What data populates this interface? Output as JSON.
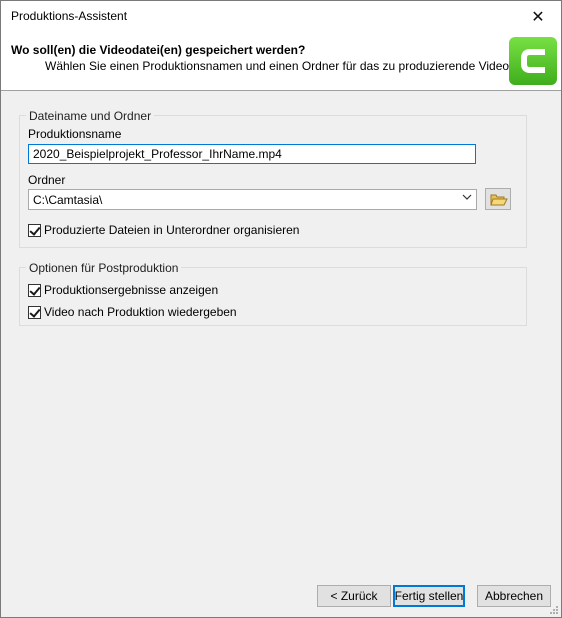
{
  "window": {
    "title": "Produktions-Assistent",
    "close_glyph": "✕"
  },
  "header": {
    "heading": "Wo soll(en) die Videodatei(en) gespeichert werden?",
    "subheading": "Wählen Sie einen Produktionsnamen und einen Ordner für das zu produzierende Video.",
    "logo_icon": "camtasia-logo-icon",
    "logo_letter": "C",
    "accent_color": "#4cbb26"
  },
  "group_file": {
    "legend": "Dateiname und Ordner",
    "production_name_label": "Produktionsname",
    "production_name_value": "2020_Beispielprojekt_Professor_IhrName.mp4",
    "folder_label": "Ordner",
    "folder_value": "C:\\Camtasia\\",
    "browse_icon": "folder-open-icon",
    "subfolder_checkbox_label": "Produzierte Dateien in Unterordner organisieren",
    "subfolder_checked": true
  },
  "group_post": {
    "legend": "Optionen für Postproduktion",
    "show_results_label": "Produktionsergebnisse anzeigen",
    "show_results_checked": true,
    "play_video_label": "Video nach Produktion wiedergeben",
    "play_video_checked": true
  },
  "footer": {
    "back_label": "< Zurück",
    "finish_label": "Fertig stellen",
    "cancel_label": "Abbrechen"
  }
}
